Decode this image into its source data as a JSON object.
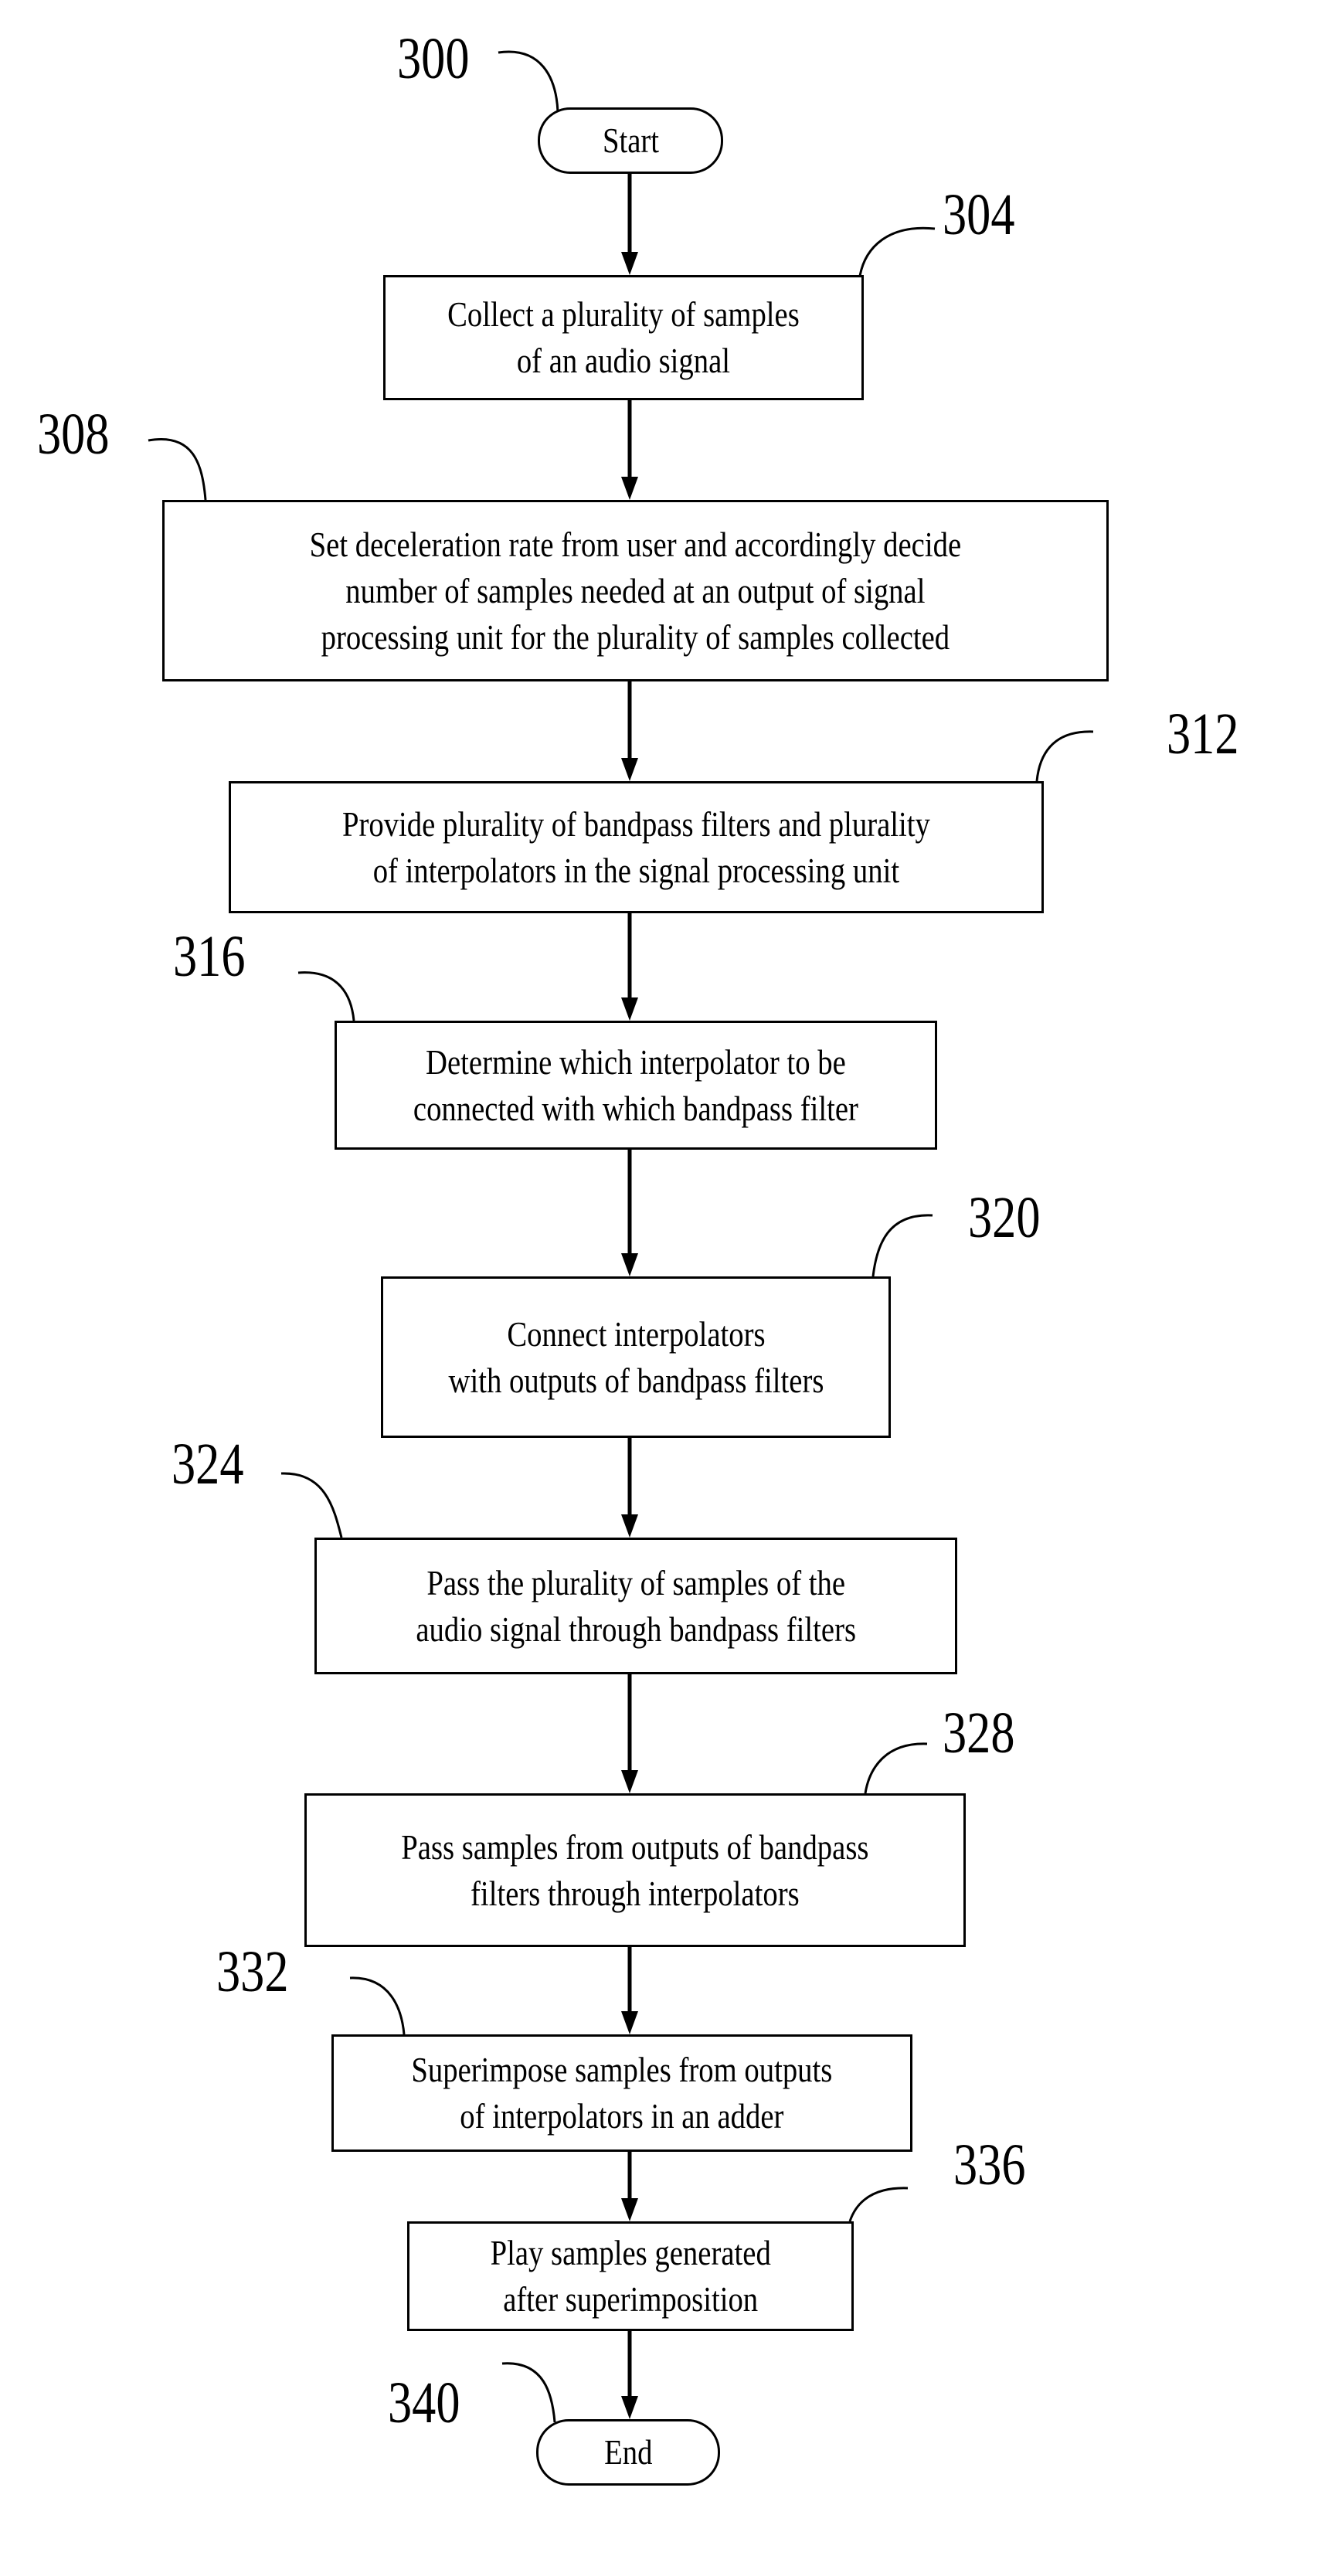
{
  "diagram": {
    "type": "flowchart",
    "figure_ref": "300",
    "nodes": [
      {
        "id": "start",
        "ref": "300",
        "shape": "terminal",
        "text": "Start"
      },
      {
        "id": "step304",
        "ref": "304",
        "shape": "process",
        "text": "Collect a plurality of samples\nof an audio signal"
      },
      {
        "id": "step308",
        "ref": "308",
        "shape": "process",
        "text": "Set deceleration rate from user and accordingly decide\nnumber of samples needed at an output of signal\nprocessing unit for the plurality of samples collected"
      },
      {
        "id": "step312",
        "ref": "312",
        "shape": "process",
        "text": "Provide plurality of bandpass filters and plurality\nof interpolators in the signal processing unit"
      },
      {
        "id": "step316",
        "ref": "316",
        "shape": "process",
        "text": "Determine which interpolator to be\nconnected with which bandpass filter"
      },
      {
        "id": "step320",
        "ref": "320",
        "shape": "process",
        "text": "Connect interpolators\nwith outputs of bandpass filters"
      },
      {
        "id": "step324",
        "ref": "324",
        "shape": "process",
        "text": "Pass the plurality of samples of the\naudio signal through bandpass filters"
      },
      {
        "id": "step328",
        "ref": "328",
        "shape": "process",
        "text": "Pass samples from outputs of bandpass\nfilters through interpolators"
      },
      {
        "id": "step332",
        "ref": "332",
        "shape": "process",
        "text": "Superimpose samples from outputs\nof interpolators in an adder"
      },
      {
        "id": "step336",
        "ref": "336",
        "shape": "process",
        "text": "Play samples generated\nafter superimposition"
      },
      {
        "id": "end",
        "ref": "340",
        "shape": "terminal",
        "text": "End"
      }
    ],
    "edges": [
      [
        "start",
        "step304"
      ],
      [
        "step304",
        "step308"
      ],
      [
        "step308",
        "step312"
      ],
      [
        "step312",
        "step316"
      ],
      [
        "step316",
        "step320"
      ],
      [
        "step320",
        "step324"
      ],
      [
        "step324",
        "step328"
      ],
      [
        "step328",
        "step332"
      ],
      [
        "step332",
        "step336"
      ],
      [
        "step336",
        "end"
      ]
    ],
    "colors": {
      "stroke": "#000000",
      "background": "#ffffff",
      "text": "#000000"
    }
  }
}
